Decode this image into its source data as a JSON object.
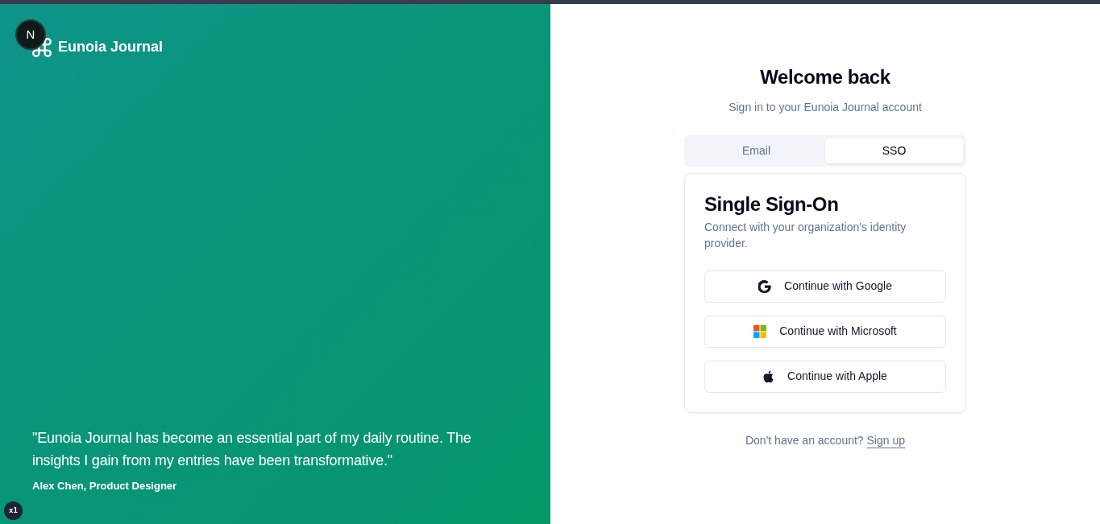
{
  "dev_badge": {
    "label": "N"
  },
  "brand": {
    "name": "Eunoia Journal"
  },
  "testimonial": {
    "quote": "\"Eunoia Journal has become an essential part of my daily routine. The insights I gain from my entries have been transformative.\"",
    "author": "Alex Chen, Product Designer"
  },
  "zoom_badge": {
    "label": "x1"
  },
  "heading": "Welcome back",
  "subheading": "Sign in to your Eunoia Journal account",
  "tabs": [
    {
      "label": "Email",
      "selected": false
    },
    {
      "label": "SSO",
      "selected": true
    }
  ],
  "card": {
    "title": "Single Sign-On",
    "description": "Connect with your organization's identity provider.",
    "buttons": [
      {
        "kind": "google",
        "label": "Continue with Google"
      },
      {
        "kind": "microsoft",
        "label": "Continue with Microsoft"
      },
      {
        "kind": "apple",
        "label": "Continue with Apple"
      }
    ]
  },
  "footer": {
    "text": "Don't have an account?",
    "link": "Sign up"
  }
}
